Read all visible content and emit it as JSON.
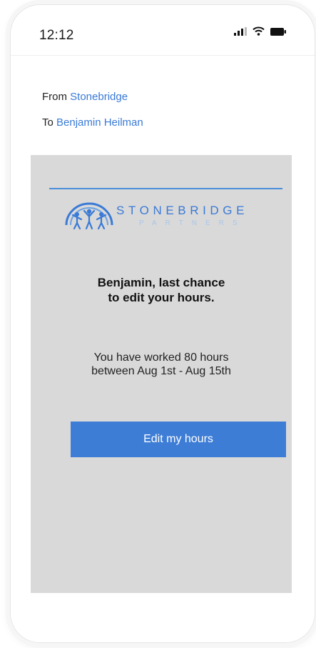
{
  "status_bar": {
    "time": "12:12",
    "icons": [
      "signal-icon",
      "wifi-icon",
      "battery-icon"
    ]
  },
  "email_header": {
    "from_label": "From",
    "from_name": "Stonebridge",
    "to_label": "To",
    "to_name": "Benjamin Heilman"
  },
  "brand": {
    "name": "STONEBRIDGE",
    "sub": "PARTNERS",
    "color": "#3a7ad6"
  },
  "message": {
    "headline_line1": "Benjamin, last chance",
    "headline_line2": "to edit your hours.",
    "summary_line1": "You have worked 80 hours",
    "summary_line2": "between Aug 1st - Aug 15th",
    "button_label": "Edit my hours"
  },
  "colors": {
    "accent": "#3d7dd6",
    "body_background": "#d9d9d9",
    "link": "#3a7ad6"
  }
}
